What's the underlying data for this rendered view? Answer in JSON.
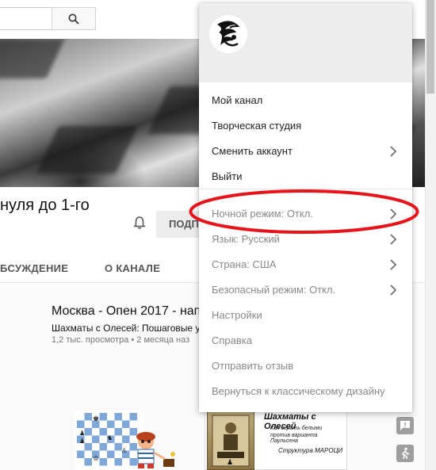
{
  "page": {
    "channel_title": "нуля до 1-го",
    "subscribe_label": "ПОДП",
    "tabs": [
      {
        "label": "БСУЖДЕНИЕ"
      },
      {
        "label": "О КАНАЛЕ"
      }
    ]
  },
  "video": {
    "title": "Москва - Опен 2017 - нап",
    "channel": "Шахматы с Олесей: Пошаговые ур",
    "meta": "1,2 тыс. просмотра • 2 месяца наз"
  },
  "thumbnail": {
    "title": "Шахматы с Олесей",
    "line1": "Как играть белыми",
    "line2": "против варианта Паульсена",
    "structure": "Структура МАРОЦИ"
  },
  "menu": {
    "section1": [
      {
        "label": "Мой канал",
        "has_chevron": false
      },
      {
        "label": "Творческая студия",
        "has_chevron": false
      },
      {
        "label": "Сменить аккаунт",
        "has_chevron": true
      },
      {
        "label": "Выйти",
        "has_chevron": false
      }
    ],
    "section2": [
      {
        "label": "Ночной режим: Откл.",
        "has_chevron": true
      },
      {
        "label": "Язык: Русский",
        "has_chevron": true
      },
      {
        "label": "Страна: США",
        "has_chevron": true
      },
      {
        "label": "Безопасный режим: Откл.",
        "has_chevron": true
      },
      {
        "label": "Настройки",
        "has_chevron": false
      },
      {
        "label": "Справка",
        "has_chevron": false
      },
      {
        "label": "Отправить отзыв",
        "has_chevron": false
      },
      {
        "label": "Вернуться к классическому дизайну",
        "has_chevron": false
      }
    ]
  },
  "icons": {
    "search": "search-icon",
    "bell": "bell-icon",
    "avatar": "avatar",
    "chevron": "chevron-right-icon",
    "feedback": "feedback-icon",
    "exit": "exit-icon"
  },
  "colors": {
    "highlight_ellipse": "#e8141b",
    "menu_header_bg": "#ededed",
    "dim_text": "#888888"
  }
}
